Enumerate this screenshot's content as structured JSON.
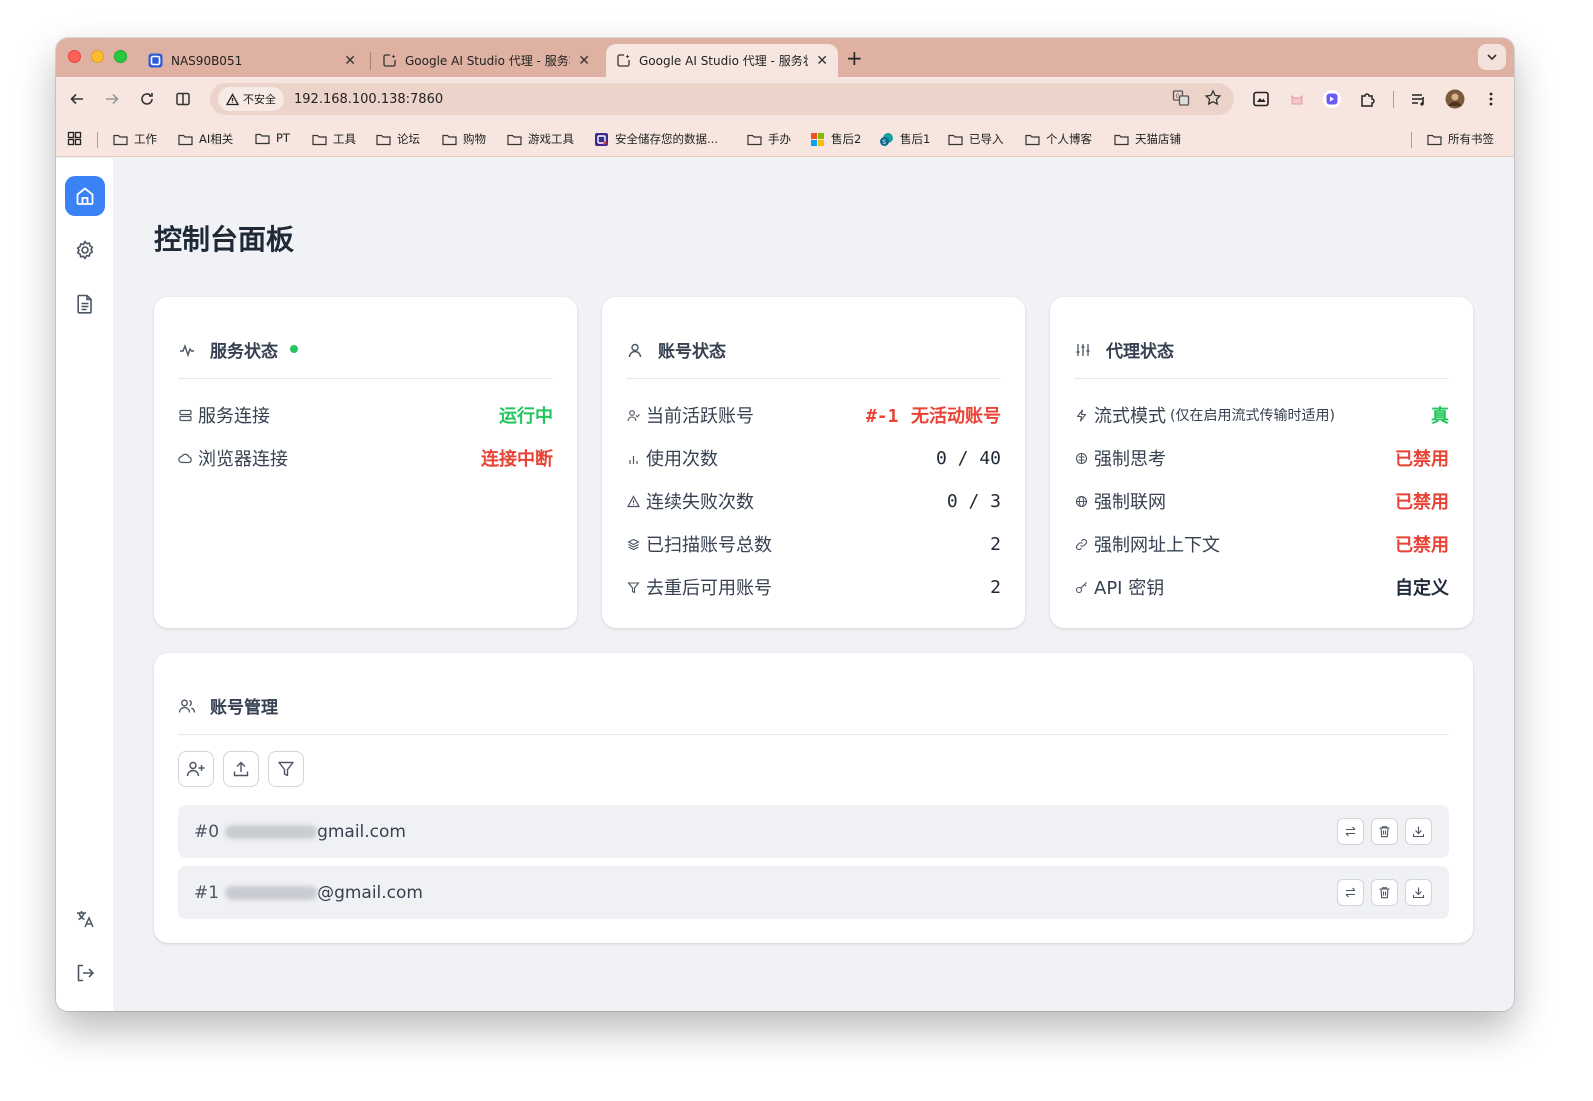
{
  "browser": {
    "tabs": [
      {
        "title": "NAS90B051",
        "close": "✕"
      },
      {
        "title": "Google AI Studio 代理 - 服务状",
        "close": "✕"
      },
      {
        "title": "Google AI Studio 代理 - 服务状",
        "close": "✕"
      }
    ],
    "new_tab": "+",
    "security_label": "不安全",
    "url": "192.168.100.138:7860",
    "bookmarks": [
      "工作",
      "AI相关",
      "PT",
      "工具",
      "论坛",
      "购物",
      "游戏工具",
      "安全储存您的数据...",
      "手办",
      "售后2",
      "售后1",
      "已导入",
      "个人博客",
      "天猫店铺"
    ],
    "all_bookmarks": "所有书签"
  },
  "page": {
    "title": "控制台面板"
  },
  "service_card": {
    "title": "服务状态",
    "rows": [
      {
        "label": "服务连接",
        "value": "运行中"
      },
      {
        "label": "浏览器连接",
        "value": "连接中断"
      }
    ]
  },
  "account_card": {
    "title": "账号状态",
    "rows": [
      {
        "label": "当前活跃账号",
        "value_id": "#-1",
        "value": "无活动账号"
      },
      {
        "label": "使用次数",
        "value": "0 / 40"
      },
      {
        "label": "连续失败次数",
        "value": "0 / 3"
      },
      {
        "label": "已扫描账号总数",
        "value": "2"
      },
      {
        "label": "去重后可用账号",
        "value": "2"
      }
    ]
  },
  "proxy_card": {
    "title": "代理状态",
    "rows": [
      {
        "label": "流式模式",
        "sub": "(仅在启用流式传输时适用)",
        "value": "真"
      },
      {
        "label": "强制思考",
        "value": "已禁用"
      },
      {
        "label": "强制联网",
        "value": "已禁用"
      },
      {
        "label": "强制网址上下文",
        "value": "已禁用"
      },
      {
        "label": "API 密钥",
        "value": "自定义"
      }
    ]
  },
  "accounts_mgmt": {
    "title": "账号管理",
    "accounts": [
      {
        "index": "#0",
        "email": "gmail.com"
      },
      {
        "index": "#1",
        "email": "@gmail.com"
      }
    ]
  },
  "colors": {
    "accent": "#3b82f6",
    "ok": "#22c55e",
    "error": "#ea4335",
    "tab_strip": "#dfb1a2"
  }
}
